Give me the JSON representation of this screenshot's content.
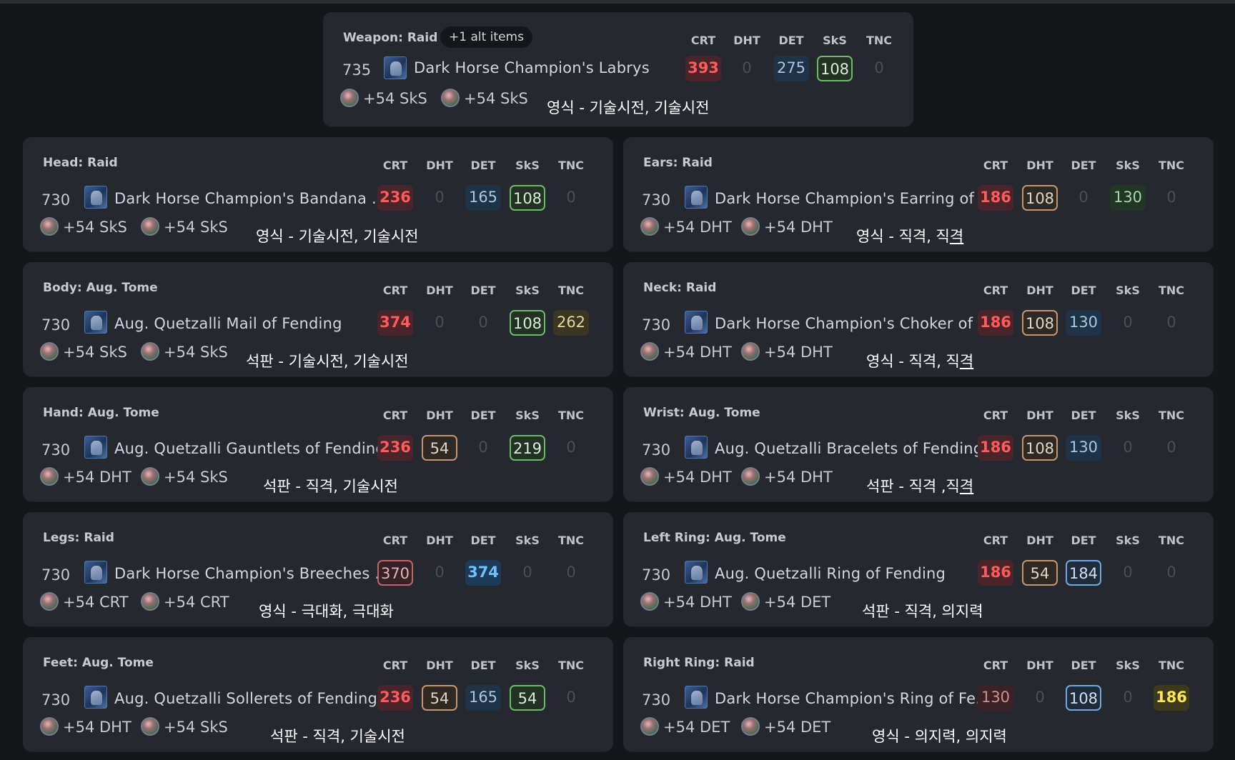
{
  "weapon": {
    "slot": "Weapon: Raid",
    "alt_items": "+1 alt items",
    "ilvl": "735",
    "name": "Dark Horse Champion's Labrys",
    "headers": [
      "CRT",
      "DHT",
      "DET",
      "SkS",
      "TNC"
    ],
    "stats": [
      "393",
      "0",
      "275",
      "108",
      "0"
    ],
    "materia": [
      "+54 SkS",
      "+54 SkS"
    ],
    "note": "영식 - 기술시전, 기술시전"
  },
  "left": [
    {
      "slot": "Head: Raid",
      "ilvl": "730",
      "name": "Dark Horse Champion's Bandana ...",
      "stats": [
        "236",
        "0",
        "165",
        "108",
        "0"
      ],
      "materia": [
        "+54 SkS",
        "+54 SkS"
      ],
      "note": "영식 - 기술시전, 기술시전"
    },
    {
      "slot": "Body: Aug. Tome",
      "ilvl": "730",
      "name": "Aug. Quetzalli Mail of Fending",
      "stats": [
        "374",
        "0",
        "0",
        "108",
        "262"
      ],
      "materia": [
        "+54 SkS",
        "+54 SkS"
      ],
      "note": "석판 - 기술시전, 기술시전"
    },
    {
      "slot": "Hand: Aug. Tome",
      "ilvl": "730",
      "name": "Aug. Quetzalli Gauntlets of Fending",
      "stats": [
        "236",
        "54",
        "0",
        "219",
        "0"
      ],
      "materia": [
        "+54 DHT",
        "+54 SkS"
      ],
      "note": "석판 - 직격, 기술시전"
    },
    {
      "slot": "Legs: Raid",
      "ilvl": "730",
      "name": "Dark Horse Champion's Breeches ...",
      "stats": [
        "370",
        "0",
        "374",
        "0",
        "0"
      ],
      "materia": [
        "+54 CRT",
        "+54 CRT"
      ],
      "note": "영식 - 극대화, 극대화"
    },
    {
      "slot": "Feet: Aug. Tome",
      "ilvl": "730",
      "name": "Aug. Quetzalli Sollerets of Fending",
      "stats": [
        "236",
        "54",
        "165",
        "54",
        "0"
      ],
      "materia": [
        "+54 DHT",
        "+54 SkS"
      ],
      "note": "석판 - 직격, 기술시전"
    }
  ],
  "right": [
    {
      "slot": "Ears: Raid",
      "ilvl": "730",
      "name": "Dark Horse Champion's Earring of ...",
      "stats": [
        "186",
        "108",
        "0",
        "130",
        "0"
      ],
      "materia": [
        "+54 DHT",
        "+54 DHT"
      ],
      "note": "영식 - 직격, 직",
      "note_u": "격"
    },
    {
      "slot": "Neck: Raid",
      "ilvl": "730",
      "name": "Dark Horse Champion's Choker of ...",
      "stats": [
        "186",
        "108",
        "130",
        "0",
        "0"
      ],
      "materia": [
        "+54 DHT",
        "+54 DHT"
      ],
      "note": "영식 - 직격, 직",
      "note_u": "격"
    },
    {
      "slot": "Wrist: Aug. Tome",
      "ilvl": "730",
      "name": "Aug. Quetzalli Bracelets of Fending",
      "stats": [
        "186",
        "108",
        "130",
        "0",
        "0"
      ],
      "materia": [
        "+54 DHT",
        "+54 DHT"
      ],
      "note": "석판 - 직격 ,직",
      "note_u": "격"
    },
    {
      "slot": "Left Ring: Aug. Tome",
      "ilvl": "730",
      "name": "Aug. Quetzalli Ring of Fending",
      "stats": [
        "186",
        "54",
        "184",
        "0",
        "0"
      ],
      "materia": [
        "+54 DHT",
        "+54 DET"
      ],
      "note": "석판 - 직격, 의지력",
      "note_u": ""
    },
    {
      "slot": "Right Ring: Raid",
      "ilvl": "730",
      "name": "Dark Horse Champion's Ring of Fe...",
      "stats": [
        "130",
        "0",
        "108",
        "0",
        "186"
      ],
      "materia": [
        "+54 DET",
        "+54 DET"
      ],
      "note": "영식 - 의지력, 의지력",
      "note_u": ""
    }
  ],
  "stat_headers": [
    "CRT",
    "DHT",
    "DET",
    "SkS",
    "TNC"
  ],
  "colors": {
    "background": "#15161a",
    "card": "#262830",
    "crit": "#ff5b5b",
    "det": "#6fc0ff",
    "sks": "#6bbb6b",
    "tnc": "#ffe45a"
  }
}
